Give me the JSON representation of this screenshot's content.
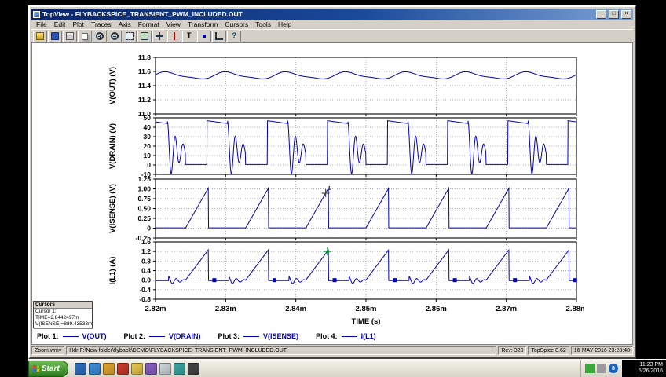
{
  "window": {
    "title": "TopView - FLYBACKSPICE_TRANSIENT_PWM_INCLUDED.OUT",
    "menu": [
      "File",
      "Edit",
      "Plot",
      "Traces",
      "Axis",
      "Format",
      "View",
      "Transform",
      "Cursors",
      "Tools",
      "Help"
    ],
    "controls": {
      "minimize": "_",
      "maximize": "□",
      "close": "×"
    }
  },
  "toolbar": {
    "buttons": [
      "open",
      "save",
      "print",
      "copy",
      "zoom-in",
      "zoom-out",
      "zoom-window",
      "zoom-full",
      "pan",
      "cursors",
      "text",
      "markers",
      "axes",
      "help"
    ]
  },
  "legend": {
    "items": [
      {
        "label": "Plot 1:",
        "trace": "V(OUT)"
      },
      {
        "label": "Plot 2:",
        "trace": "V(DRAIN)"
      },
      {
        "label": "Plot 3:",
        "trace": "V(ISENSE)"
      },
      {
        "label": "Plot 4:",
        "trace": "I(L1)"
      }
    ]
  },
  "cursor_box": {
    "title": "Cursors",
    "lines": [
      "Cursor 1:",
      "TIME=2.8442497m",
      "V(ISENSE)=889.43533m"
    ]
  },
  "status_bar": {
    "cells": [
      "Zoom.wmv",
      "Hdr F:\\New folder\\flyback\\DEMO\\FLYBACKSPICE_TRANSIENT_PWM_INCLUDED.OUT",
      "Rev: 328",
      "TopSpice 8.62",
      "16-MAY-2016  23:23:48"
    ]
  },
  "taskbar": {
    "start_label": "Start",
    "quicklaunch": [
      {
        "name": "show-desktop",
        "color": "#2e6fbf"
      },
      {
        "name": "internet-explorer",
        "color": "#3f8edc"
      },
      {
        "name": "mail",
        "color": "#e0a52f"
      },
      {
        "name": "media-player",
        "color": "#cc3a2a"
      },
      {
        "name": "folder",
        "color": "#e8c84a"
      },
      {
        "name": "paint",
        "color": "#8a5fc0"
      },
      {
        "name": "notepad",
        "color": "#cfd8e0"
      },
      {
        "name": "tools",
        "color": "#3aa6a0"
      },
      {
        "name": "recorder",
        "color": "#444444"
      }
    ],
    "tray_icons": [
      {
        "name": "network",
        "color": "#3aa63a",
        "shape": "square",
        "glyph": ""
      },
      {
        "name": "volume",
        "color": "#9a9a9a",
        "shape": "square",
        "glyph": ""
      },
      {
        "name": "messenger",
        "color": "#1464c8",
        "shape": "circle",
        "glyph": "8"
      }
    ],
    "clock_time": "11:23 PM",
    "clock_date": "5/26/2016"
  },
  "time_axis": {
    "label": "TIME  (s)",
    "tick_labels": [
      "2.82m",
      "2.83m",
      "2.84m",
      "2.85m",
      "2.86m",
      "2.87m",
      "2.88m"
    ],
    "t_start_ms": 2.82,
    "t_end_ms": 2.88,
    "period_ms": 0.00857,
    "phase_ms": -0.0043
  },
  "chart_data": [
    {
      "type": "line",
      "name": "V(OUT)",
      "color": "#0000bb",
      "ylabel": "V(OUT)  (V)",
      "ylim": [
        11.0,
        11.8
      ],
      "yticks": [
        11.8,
        11.6,
        11.4,
        11.2,
        11.0
      ],
      "ytick_labels": [
        "11.8",
        "11.6",
        "11.4",
        "11.2",
        "11.0"
      ],
      "waveform": "vout",
      "params": {
        "base": 11.54,
        "ripple_amp": 0.045,
        "h2": 0.013
      }
    },
    {
      "type": "line",
      "name": "V(DRAIN)",
      "color": "#0000bb",
      "ylabel": "V(DRAIN)  (V)",
      "ylim": [
        -10,
        50
      ],
      "yticks": [
        50,
        40,
        30,
        20,
        10,
        0,
        -10
      ],
      "ytick_labels": [
        "50",
        "40",
        "30",
        "20",
        "10",
        "0",
        "-10"
      ],
      "waveform": "vdrain",
      "params": {
        "on_frac": 0.36,
        "flat_frac": 0.7,
        "v_on": 0.5,
        "v_flat": 47,
        "v_flat_end": 44,
        "ring_center": 14,
        "ring_amp": 33,
        "ring_cycles": 2.3,
        "ring_decay": 1.6
      }
    },
    {
      "type": "line",
      "name": "V(ISENSE)",
      "color": "#0000bb",
      "ylabel": "V(ISENSE)  (V)",
      "ylim": [
        -0.25,
        1.25
      ],
      "yticks": [
        1.25,
        1.0,
        0.75,
        0.5,
        0.25,
        0,
        -0.25
      ],
      "ytick_labels": [
        "1.25",
        "1.00",
        "0.75",
        "0.50",
        "0.25",
        "0",
        "-0.25"
      ],
      "waveform": "visense",
      "params": {
        "ramp_frac": 0.38,
        "peak": 1.02
      },
      "cursor": {
        "t_ms": 2.8442497,
        "value": 0.8894,
        "color": "#444444",
        "label": "1"
      }
    },
    {
      "type": "line",
      "name": "I(L1)",
      "color": "#0000bb",
      "ylabel": "I(L1)  (A)",
      "ylim": [
        -0.8,
        1.6
      ],
      "yticks": [
        1.6,
        1.2,
        0.8,
        0.4,
        0,
        -0.4,
        -0.8
      ],
      "ytick_labels": [
        "1.6",
        "1.2",
        "0.8",
        "0.4",
        "0.0",
        "-0.4",
        "-0.8"
      ],
      "waveform": "il1",
      "params": {
        "ramp_frac": 0.38,
        "peak": 1.27,
        "rest_frac": 0.72,
        "ring_amp": 0.17,
        "ring_cycles": 2.2,
        "ring_decay": 1.5
      },
      "cursor": {
        "t_ms": 2.8445,
        "value": 1.2,
        "color": "#00a020",
        "label": ""
      },
      "markers": {
        "shape": "square",
        "color": "#0000bb",
        "phase": 0.48
      }
    }
  ]
}
